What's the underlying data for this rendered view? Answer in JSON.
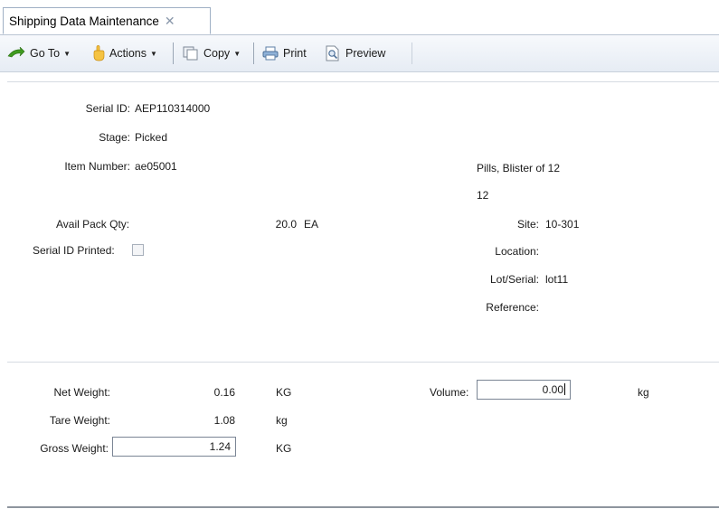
{
  "tab": {
    "title": "Shipping Data Maintenance",
    "close_icon": "close-icon"
  },
  "toolbar": {
    "goto_label": "Go To",
    "actions_label": "Actions",
    "copy_label": "Copy",
    "print_label": "Print",
    "preview_label": "Preview"
  },
  "header_section": {
    "serial_id_label": "Serial ID:",
    "serial_id_value": "AEP110314000",
    "stage_label": "Stage:",
    "stage_value": "Picked",
    "item_number_label": "Item Number:",
    "item_number_value": "ae05001",
    "item_description": "Pills, Blister of 12",
    "item_description_2": "12",
    "avail_pack_qty_label": "Avail Pack Qty:",
    "avail_pack_qty_value": "20.0",
    "avail_pack_qty_uom": "EA",
    "serial_id_printed_label": "Serial ID Printed:",
    "serial_id_printed_checked": false,
    "site_label": "Site:",
    "site_value": "10-301",
    "location_label": "Location:",
    "location_value": "",
    "lot_serial_label": "Lot/Serial:",
    "lot_serial_value": "lot11",
    "reference_label": "Reference:",
    "reference_value": ""
  },
  "weight_section": {
    "net_weight_label": "Net Weight:",
    "net_weight_value": "0.16",
    "net_weight_uom": "KG",
    "tare_weight_label": "Tare Weight:",
    "tare_weight_value": "1.08",
    "tare_weight_uom": "kg",
    "gross_weight_label": "Gross Weight:",
    "gross_weight_value": "1.24",
    "gross_weight_uom": "KG",
    "volume_label": "Volume:",
    "volume_value": "0.00",
    "volume_uom": "kg"
  },
  "colors": {
    "toolbar_bg": "#e6ecf4",
    "tab_border": "#9fb0c5",
    "divider": "#d6dbe2",
    "input_border": "#7a8594"
  }
}
